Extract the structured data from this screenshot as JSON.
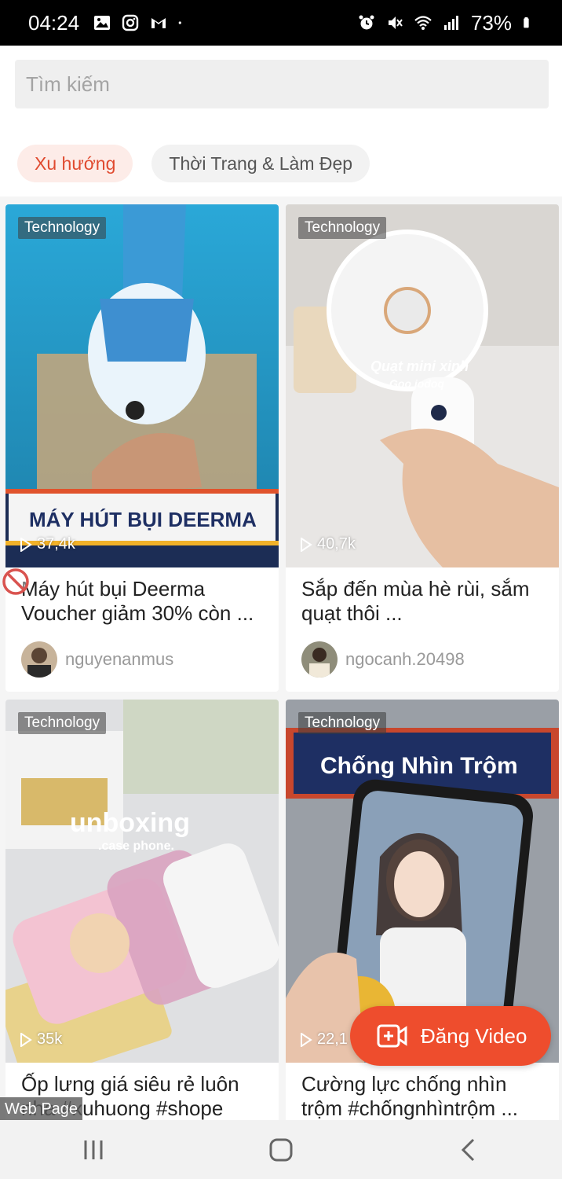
{
  "status_bar": {
    "time": "04:24",
    "battery": "73%",
    "left_icons": [
      "image-icon",
      "instagram-icon",
      "gmail-icon",
      "dot-icon"
    ],
    "right_icons": [
      "alarm-icon",
      "mute-icon",
      "wifi-icon",
      "signal-icon",
      "battery-icon"
    ]
  },
  "search": {
    "placeholder": "Tìm kiếm"
  },
  "chips": [
    {
      "label": "Xu hướng",
      "active": true
    },
    {
      "label": "Thời Trang & Làm Đẹp",
      "active": false
    }
  ],
  "cards": [
    {
      "tag": "Technology",
      "views": "37,4k",
      "overlay": "MÁY HÚT BỤI DEERMA",
      "title": "Máy hút bụi Deerma Voucher giảm 30% còn ...",
      "author": "nguyenanmus"
    },
    {
      "tag": "Technology",
      "views": "40,7k",
      "overlay": "Quạt mini xinh",
      "overlay_sub": "Goo jodoq",
      "title": "Sắp đến mùa hè rùi, sắm quạt thôi ...",
      "author": "ngocanh.20498"
    },
    {
      "tag": "Technology",
      "views": "35k",
      "overlay": "unboxing",
      "overlay_sub": ".case phone.",
      "title": "Ốp lưng giá siêu rẻ luôn nha #xuhuong #shope",
      "author": ""
    },
    {
      "tag": "Technology",
      "views": "22,1",
      "overlay": "Chống Nhìn Trộm",
      "title": "Cường lực chống nhìn trộm #chốngnhìntrộm ...",
      "author": ""
    }
  ],
  "fab": {
    "label": "Đăng Video"
  },
  "webpage_label": "Web Page",
  "colors": {
    "accent": "#ee4d2d",
    "chip_active_bg": "#fdece8"
  }
}
